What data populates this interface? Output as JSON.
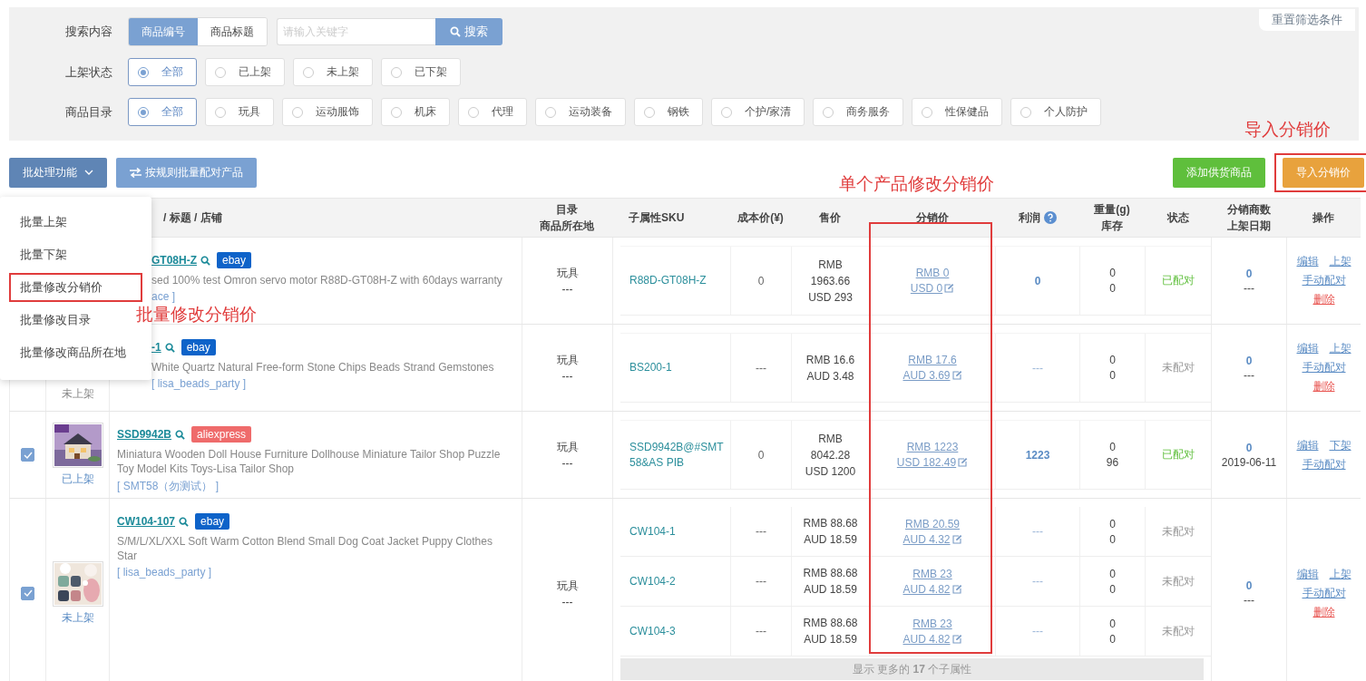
{
  "filters": {
    "reset": "重置筛选条件",
    "search": {
      "label": "搜索内容",
      "modes": [
        {
          "label": "商品编号",
          "selected": true
        },
        {
          "label": "商品标题",
          "selected": false
        }
      ],
      "placeholder": "请输入关键字",
      "button": "搜索"
    },
    "groups": [
      {
        "label": "上架状态",
        "options": [
          {
            "label": "全部",
            "selected": true
          },
          {
            "label": "已上架",
            "selected": false
          },
          {
            "label": "未上架",
            "selected": false
          },
          {
            "label": "已下架",
            "selected": false
          }
        ]
      },
      {
        "label": "商品目录",
        "options": [
          {
            "label": "全部",
            "selected": true
          },
          {
            "label": "玩具",
            "selected": false
          },
          {
            "label": "运动服饰",
            "selected": false
          },
          {
            "label": "机床",
            "selected": false
          },
          {
            "label": "代理",
            "selected": false
          },
          {
            "label": "运动装备",
            "selected": false
          },
          {
            "label": "钢铁",
            "selected": false
          },
          {
            "label": "个护/家清",
            "selected": false
          },
          {
            "label": "商务服务",
            "selected": false
          },
          {
            "label": "性保健品",
            "selected": false
          },
          {
            "label": "个人防护",
            "selected": false
          }
        ]
      }
    ]
  },
  "toolbar": {
    "batch_button": "批处理功能",
    "match_button": "按规则批量配对产品",
    "add_button": "添加供货商品",
    "import_button": {
      "label": "导入分销价",
      "highlighted": true,
      "note": "导入分销价"
    }
  },
  "batch_menu": {
    "note": "批量修改分销价",
    "items": [
      {
        "label": "批量上架",
        "highlighted": false
      },
      {
        "label": "批量下架",
        "highlighted": false
      },
      {
        "label": "批量修改分销价",
        "highlighted": true
      },
      {
        "label": "批量修改目录",
        "highlighted": false
      },
      {
        "label": "批量修改商品所在地",
        "highlighted": false
      }
    ]
  },
  "table": {
    "columns": [
      {
        "lines": [
          "/ 标题 / 店铺"
        ]
      },
      {
        "lines": [
          "目录",
          "商品所在地"
        ]
      },
      {
        "lines": [
          "子属性SKU"
        ]
      },
      {
        "lines": [
          "成本价(¥)"
        ]
      },
      {
        "lines": [
          "售价"
        ]
      },
      {
        "lines": [
          "分销价"
        ],
        "highlighted": true,
        "note": "单个产品修改分销价"
      },
      {
        "lines": [
          "利润"
        ],
        "help": true
      },
      {
        "lines": [
          "重量(g)",
          "库存"
        ]
      },
      {
        "lines": [
          "状态"
        ]
      },
      {
        "lines": [
          "分销商数",
          "上架日期"
        ]
      },
      {
        "lines": [
          "操作"
        ]
      }
    ],
    "rows": [
      {
        "covered": true,
        "sku": "GT08H-Z",
        "platform": {
          "label": "ebay",
          "color": "#0e63c9"
        },
        "title": "sed 100% test Omron servo motor R88D-GT08H-Z with 60days warranty",
        "store": "ace ]",
        "catalog": "玩具",
        "location": "---",
        "variants": [
          {
            "sku": "R88D-GT08H-Z",
            "cost": "0",
            "price": [
              "RMB",
              "1963.66",
              "USD 293"
            ],
            "dist": [
              "RMB 0",
              "USD 0"
            ],
            "profit": "0",
            "profit_bold": true,
            "weight": "0",
            "stock": "0",
            "status": "已配对",
            "matched": true
          }
        ],
        "distributors": "0",
        "date": "---",
        "actions": [
          {
            "label": "编辑",
            "kind": "link"
          },
          {
            "label": "上架",
            "kind": "link"
          },
          {
            "label": "手动配对",
            "kind": "link"
          },
          {
            "label": "删除",
            "kind": "danger"
          }
        ]
      },
      {
        "covered": true,
        "listing_status": "未上架",
        "sku": "-1",
        "platform": {
          "label": "ebay",
          "color": "#0e63c9"
        },
        "title": "White Quartz Natural Free-form Stone Chips Beads Strand Gemstones",
        "store": "[ lisa_beads_party ]",
        "catalog": "玩具",
        "location": "---",
        "variants": [
          {
            "sku": "BS200-1",
            "cost": "---",
            "price": [
              "RMB 16.6",
              "AUD 3.48"
            ],
            "dist": [
              "RMB 17.6",
              "AUD 3.69"
            ],
            "profit": "---",
            "profit_bold": false,
            "weight": "0",
            "stock": "0",
            "status": "未配对",
            "matched": false
          }
        ],
        "distributors": "0",
        "date": "---",
        "actions": [
          {
            "label": "编辑",
            "kind": "link"
          },
          {
            "label": "上架",
            "kind": "link"
          },
          {
            "label": "手动配对",
            "kind": "link"
          },
          {
            "label": "删除",
            "kind": "danger"
          }
        ]
      },
      {
        "covered": false,
        "checked": true,
        "thumbnail": {
          "kind": "picture"
        },
        "listing_status": "已上架",
        "sku": "SSD9942B",
        "platform": {
          "label": "aliexpress",
          "color": "#ef6b6b"
        },
        "title": "Miniatura Wooden Doll House Furniture Dollhouse Miniature Tailor Shop Puzzle Toy Model Kits Toys-Lisa Tailor Shop",
        "store": "[ SMT58（勿测试） ]",
        "catalog": "玩具",
        "location": "---",
        "variants": [
          {
            "sku": "SSD9942B@#SMT58&AS PIB",
            "cost": "0",
            "price": [
              "RMB",
              "8042.28",
              "USD 1200"
            ],
            "dist": [
              "RMB 1223",
              "USD 182.49"
            ],
            "profit": "1223",
            "profit_bold": true,
            "weight": "0",
            "stock": "96",
            "status": "已配对",
            "matched": true
          }
        ],
        "distributors": "0",
        "date": "2019-06-11",
        "actions": [
          {
            "label": "编辑",
            "kind": "link"
          },
          {
            "label": "下架",
            "kind": "link"
          },
          {
            "label": "手动配对",
            "kind": "link"
          }
        ]
      },
      {
        "covered": false,
        "checked": true,
        "thumbnail": {
          "kind": "picture"
        },
        "listing_status": "未上架",
        "sku": "CW104-107",
        "platform": {
          "label": "ebay",
          "color": "#0e63c9"
        },
        "title": "S/M/L/XL/XXL Soft Warm Cotton Blend Small Dog Coat Jacket Puppy Clothes Star",
        "store": "[ lisa_beads_party ]",
        "catalog": "玩具",
        "location": "---",
        "variants": [
          {
            "sku": "CW104-1",
            "cost": "---",
            "price": [
              "RMB 88.68",
              "AUD 18.59"
            ],
            "dist": [
              "RMB 20.59",
              "AUD 4.32"
            ],
            "profit": "---",
            "profit_bold": false,
            "weight": "0",
            "stock": "0",
            "status": "未配对",
            "matched": false
          },
          {
            "sku": "CW104-2",
            "cost": "---",
            "price": [
              "RMB 88.68",
              "AUD 18.59"
            ],
            "dist": [
              "RMB 23",
              "AUD 4.82"
            ],
            "profit": "---",
            "profit_bold": false,
            "weight": "0",
            "stock": "0",
            "status": "未配对",
            "matched": false
          },
          {
            "sku": "CW104-3",
            "cost": "---",
            "price": [
              "RMB 88.68",
              "AUD 18.59"
            ],
            "dist": [
              "RMB 23",
              "AUD 4.82"
            ],
            "profit": "---",
            "profit_bold": false,
            "weight": "0",
            "stock": "0",
            "status": "未配对",
            "matched": false
          }
        ],
        "more": "显示 更多的 **17** 个子属性",
        "distributors": "0",
        "date": "---",
        "actions": [
          {
            "label": "编辑",
            "kind": "link"
          },
          {
            "label": "上架",
            "kind": "link"
          },
          {
            "label": "手动配对",
            "kind": "link"
          },
          {
            "label": "删除",
            "kind": "danger"
          }
        ]
      }
    ]
  }
}
